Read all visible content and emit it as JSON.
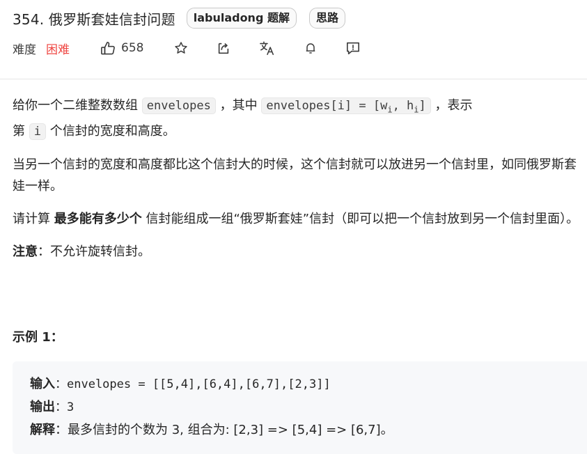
{
  "problem": {
    "title": "354. 俄罗斯套娃信封问题",
    "tags": [
      "labuladong 题解",
      "思路"
    ],
    "difficulty_label": "难度",
    "difficulty": "困难",
    "likes": "658",
    "colors": {
      "difficulty": "#ef4743"
    }
  },
  "description": {
    "p1_a": "给你一个二维整数数组",
    "p1_code1": "envelopes",
    "p1_b": "，其中",
    "p1_code2_prefix": "envelopes[i] = [w",
    "p1_code2_sub1": "i",
    "p1_code2_mid": ", h",
    "p1_code2_sub2": "i",
    "p1_code2_suffix": "]",
    "p1_c": "，表示",
    "p1_d": "第",
    "p1_code3": "i",
    "p1_e": "个信封的宽度和高度。",
    "p2": "当另一个信封的宽度和高度都比这个信封大的时候，这个信封就可以放进另一个信封里，如同俄罗斯套娃一样。",
    "p3_a": "请计算",
    "p3_b": "最多能有多少个",
    "p3_c": "信封能组成一组“俄罗斯套娃”信封（即可以把一个信封放到另一个信封里面）。",
    "note_label": "注意",
    "note_text": "：不允许旋转信封。"
  },
  "example": {
    "title": "示例 1：",
    "input_label": "输入",
    "input_value": "：envelopes = [[5,4],[6,4],[6,7],[2,3]]",
    "output_label": "输出",
    "output_value": "：3",
    "explain_label": "解释",
    "explain_value": "：最多信封的个数为 3, 组合为: [2,3] => [5,4] => [6,7]。"
  }
}
